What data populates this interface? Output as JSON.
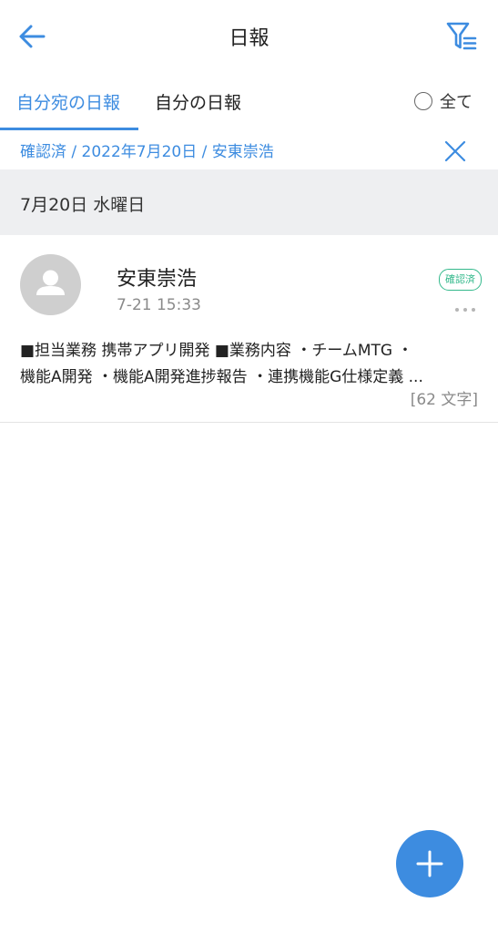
{
  "header": {
    "title": "日報",
    "back_icon": "arrow-left-icon",
    "filter_icon": "filter-list-icon"
  },
  "tabs": {
    "received": "自分宛の日報",
    "mine": "自分の日報",
    "all_label": "全て",
    "all_checked": false
  },
  "filter_bar": {
    "text": "確認済 / 2022年7月20日 / 安東崇浩",
    "clear_icon": "close-icon"
  },
  "reports": [
    {
      "date_label": "7月20日 水曜日",
      "author": "安東崇浩",
      "time": "7-21 15:33",
      "status": "確認済",
      "summary_line1": "■担当業務 携帯アプリ開発 ■業務内容 ・チームMTG ・",
      "summary_line2": "機能A開発 ・機能A開発進捗報告 ・連携機能G仕様定義 ...",
      "char_count": "[62 文字]"
    }
  ],
  "fab": {
    "icon": "plus-icon"
  },
  "colors": {
    "accent": "#3d8ce0",
    "status_green": "#34b98c",
    "muted_text": "#8a8a8a",
    "section_bg": "#eeeff1"
  }
}
